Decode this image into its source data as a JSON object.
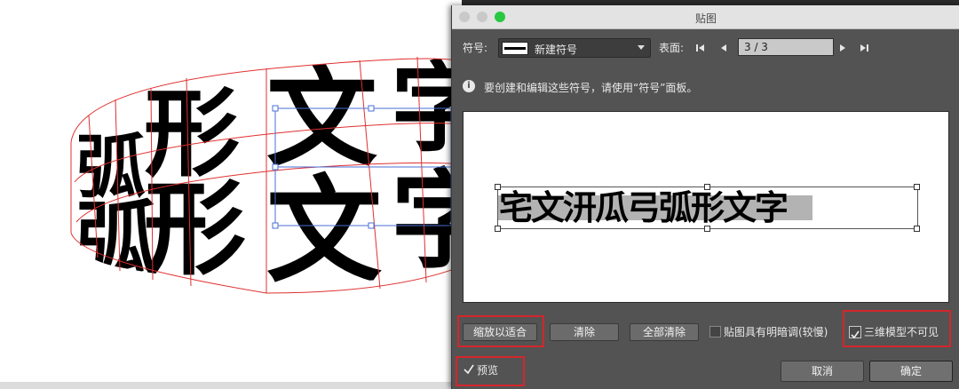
{
  "dialog": {
    "title": "贴图",
    "symbol_label": "符号:",
    "symbol_value": "新建符号",
    "surface_label": "表面:",
    "surface_value": "3 / 3",
    "info_text": "要创建和编辑这些符号，请使用“符号”面板。",
    "preview_text": "宅文汧瓜弓弧形文字",
    "buttons": {
      "scale_to_fit": "缩放以适合",
      "clear": "清除",
      "clear_all": "全部清除",
      "cancel": "取消",
      "ok": "确定"
    },
    "checkboxes": {
      "shade_artwork": "贴图具有明暗调(较慢)",
      "invisible_geometry": "三维模型不可见",
      "preview": "预览"
    }
  },
  "canvas": {
    "top_row_chars": [
      "弧",
      "形",
      "文",
      "字"
    ],
    "bottom_row_chars": [
      "弧",
      "形",
      "文",
      "字"
    ]
  },
  "colors": {
    "highlight": "#d4262b",
    "panel": "#535353",
    "mesh": "#e03030",
    "selection": "#4a6fd6"
  },
  "icons": {
    "close": "traffic-red",
    "minimize": "traffic-yellow",
    "zoom": "traffic-green",
    "first": "first-page-icon",
    "prev": "prev-page-icon",
    "next": "next-page-icon",
    "last": "last-page-icon"
  }
}
